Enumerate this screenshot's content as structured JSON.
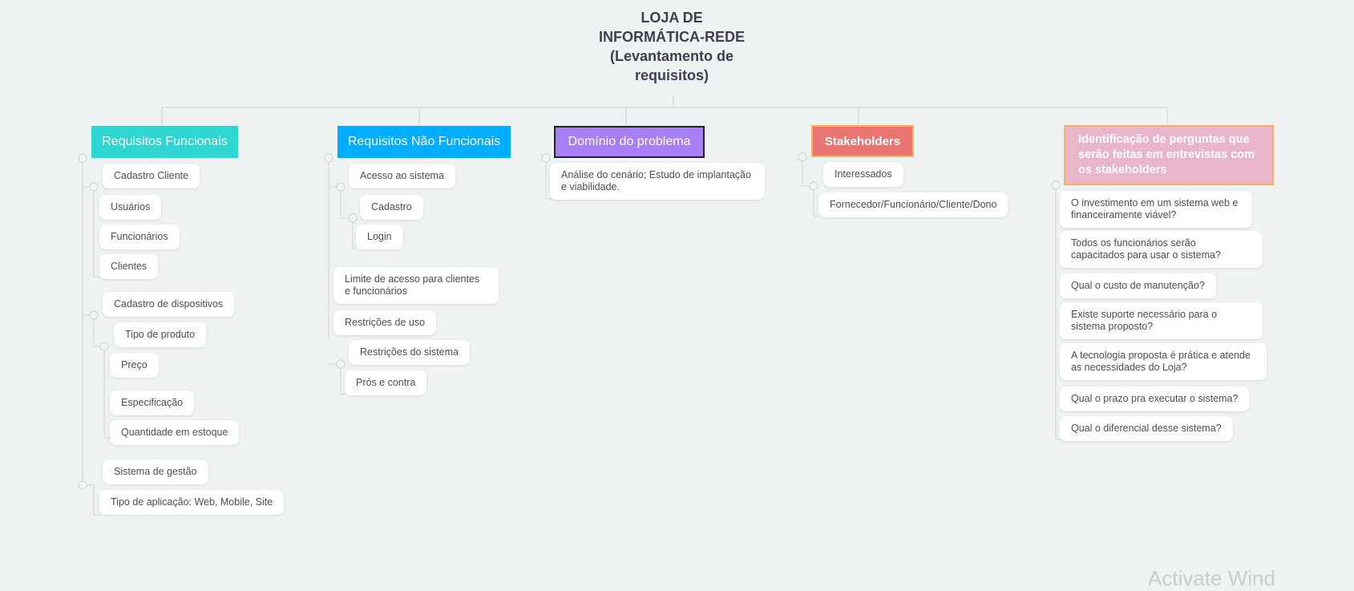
{
  "root": {
    "title": "LOJA DE\nINFORMÁTICA-REDE\n(Levantamento de\nrequisitos)"
  },
  "branches": {
    "funcionais": {
      "label": "Requisitos Funcionais",
      "items": {
        "cadastro_cliente": "Cadastro Cliente",
        "usuarios": "Usuários",
        "funcionarios": "Funcionários",
        "clientes": "Clientes",
        "cadastro_dispositivos": "Cadastro de dispositivos",
        "tipo_produto": "Tipo de produto",
        "preco": "Preço",
        "especificacao": "Especificação",
        "quantidade_estoque": "Quantidade em estoque",
        "sistema_gestao": "Sistema de gestão",
        "tipo_aplicacao": "Tipo de aplicação: Web, Mobile, Site"
      }
    },
    "nao_funcionais": {
      "label": "Requisitos Não Funcionais",
      "items": {
        "acesso_sistema": "Acesso ao sistema",
        "cadastro": "Cadastro",
        "login": "Login",
        "limite_acesso": "Limite de acesso para clientes e funcionários",
        "restricoes_uso": "Restrições de uso",
        "restricoes_sistema": "Restrições do sistema",
        "pros_contra": "Prós e contra"
      }
    },
    "dominio": {
      "label": "Domínio do problema",
      "items": {
        "analise": "Análise do cenário; Estudo de implantação e viabilidade."
      }
    },
    "stakeholders": {
      "label": "Stakeholders",
      "items": {
        "interessados": "Interessados",
        "fornecedor": "Fornecedor/Funcionário/Cliente/Dono"
      }
    },
    "identificacao": {
      "label": "Identificação de perguntas que serão feitas em entrevistas com os stakeholders",
      "items": {
        "q1": "O investimento em um sistema web e financeiramente viável?",
        "q2": "Todos os funcionários serão capacitados para usar o sistema?",
        "q3": "Qual o custo de manutenção?",
        "q4": "Existe suporte necessário para o sistema proposto?",
        "q5": "A tecnologia proposta é prática e atende as necessidades do Loja?",
        "q6": "Qual o prazo pra executar o sistema?",
        "q7": "Qual o diferencial desse sistema?"
      }
    }
  },
  "watermark": "Activate Wind",
  "colors": {
    "background": "#eff2f2",
    "funcionais": "#2ed6d1",
    "nao_funcionais": "#00aeff",
    "dominio": "#a87ef4",
    "stakeholders": "#ea7472",
    "identificacao": "#e9b5cb",
    "connector": "#d8dcdd"
  }
}
